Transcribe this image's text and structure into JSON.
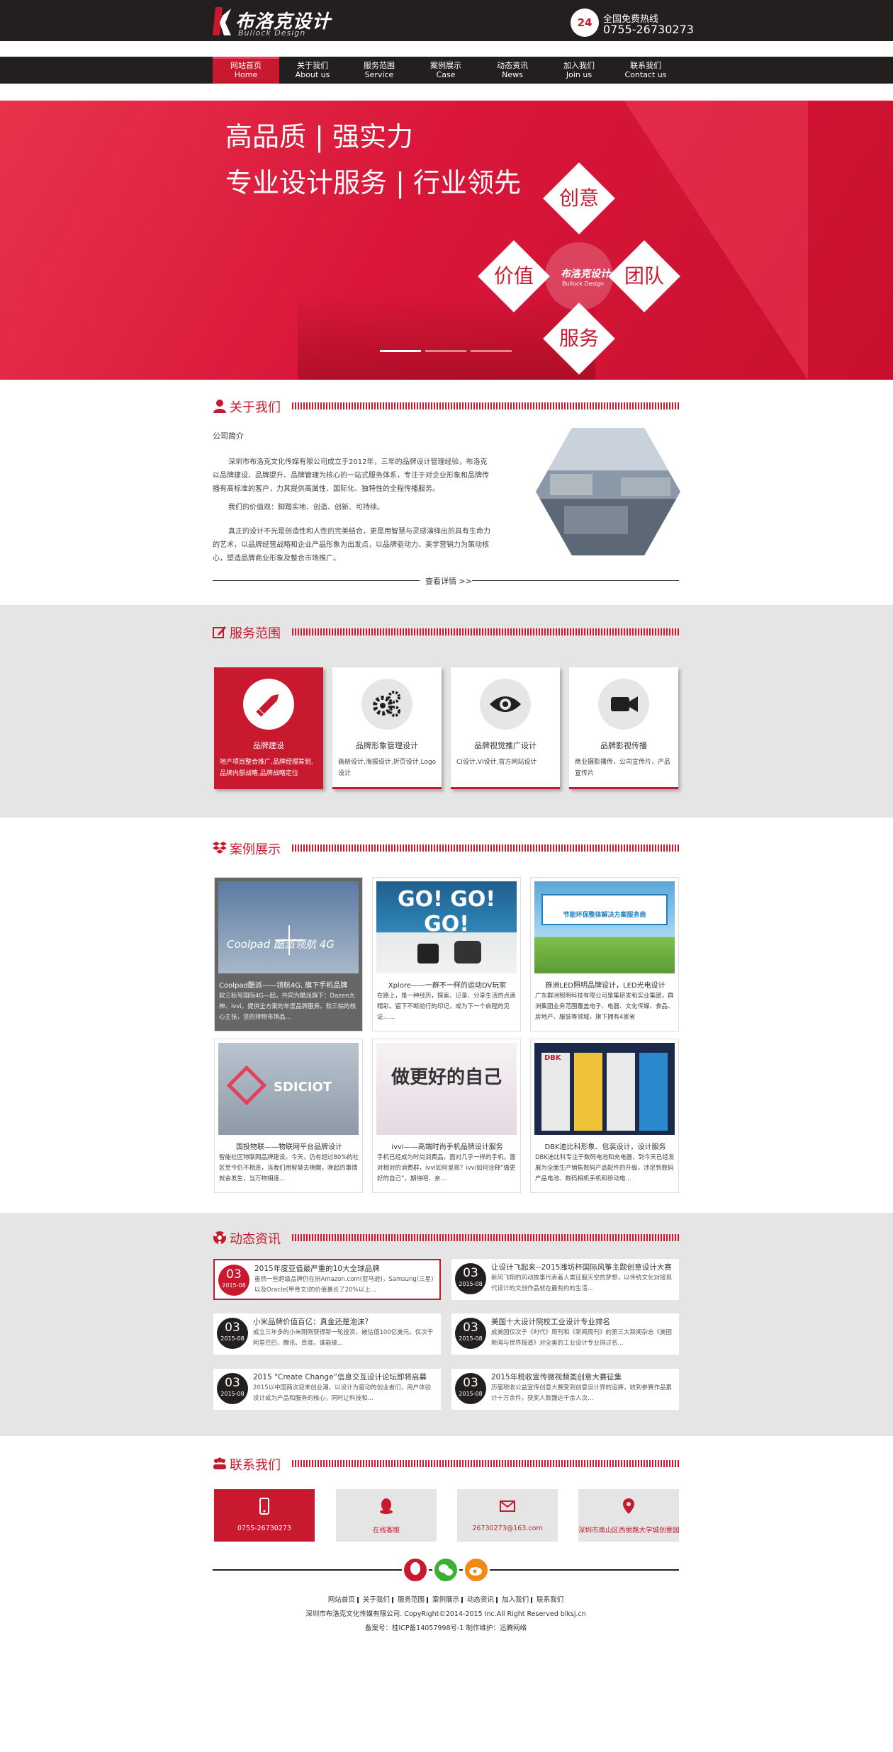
{
  "header": {
    "logo_cn": "布洛克设计",
    "logo_en": "Bullock Design",
    "hotline_badge": "24",
    "hotline_label": "全国免费热线",
    "hotline_number": "0755-26730273"
  },
  "nav": [
    {
      "cn": "网站首页",
      "en": "Home"
    },
    {
      "cn": "关于我们",
      "en": "About us"
    },
    {
      "cn": "服务范围",
      "en": "Service"
    },
    {
      "cn": "案例展示",
      "en": "Case"
    },
    {
      "cn": "动态资讯",
      "en": "News"
    },
    {
      "cn": "加入我们",
      "en": "Join us"
    },
    {
      "cn": "联系我们",
      "en": "Contact us"
    }
  ],
  "banner": {
    "line1": "高品质 | 强实力",
    "line2": "专业设计服务 | 行业领先",
    "words": [
      "创意",
      "价值",
      "团队",
      "服务"
    ],
    "center_logo": "布洛克设计",
    "center_logo_en": "Bullock Design"
  },
  "about": {
    "title": "关于我们",
    "subtitle": "公司简介",
    "p1": "深圳市布洛克文化传媒有限公司成立于2012年，三年的品牌设计管理经验，布洛克以品牌建设、品牌提升、品牌管理为核心的一站式服务体系，专注于对企业形象和品牌传播有高标准的客户，力其提供高属性、国际化、独特性的全程传播服务。",
    "p2": "我们的价值观：脚踏实地、创造、创新、可持续。",
    "p3": "真正的设计不光是创造性和人性的完美结合，更是用智慧与灵感演绎出的具有生命力的艺术，以品牌经营战略和企业产品形象为出发点，以品牌驱动力、美学营销力为策动核心，塑造品牌商业形象及整合市场推广。",
    "more": "查看详情 >>"
  },
  "services": {
    "title": "服务范围",
    "cards": [
      {
        "title": "品牌建设",
        "desc": "地产项目整合推广,品牌经理筹划,品牌内部战略,品牌战略定位",
        "icon": "pencil-icon"
      },
      {
        "title": "品牌形象管理设计",
        "desc": "画册设计,海报设计,折页设计,Logo设计",
        "icon": "gears-icon"
      },
      {
        "title": "品牌视觉推广设计",
        "desc": "CI设计,VI设计,官方网站设计",
        "icon": "eye-icon"
      },
      {
        "title": "品牌影视传播",
        "desc": "商业摄影播传，公司宣传片，产品宣传片",
        "icon": "video-camera-icon"
      }
    ]
  },
  "cases": {
    "title": "案例展示",
    "items": [
      {
        "title": "Coolpad酷派——领航4G, 旗下手机品牌",
        "desc": "软三标号国际4G—起，共同为酷派旗下：Dazen大神、ivvi。提供全方案的年度品牌服务。软三棕的核心主张，坚的持物市场品...",
        "img_text": "Coolpad 酷派领航 4G"
      },
      {
        "title": "Xplore——一群不一样的运动DV玩家",
        "desc": "在路上，是一种经历，探索、记录、分享生活的点滴精彩。留下不断前行的印记，成为下一个启程的见证……",
        "img_text": "GO! GO! GO!"
      },
      {
        "title": "群洲LED照明品牌设计，LED光电设计",
        "desc": "广东群洲照明科技有限公司是集研发和实业集团，群洲集团业务范围覆盖电子、电器、文化传媒、食品、房地产、服装等领域，旗下拥有4家省",
        "img_text": "节能环保整体解决方案服务商"
      },
      {
        "title": "国投物联——物联网平台品牌设计",
        "desc": "智能社区物联网品牌建设。今天，仍有超过80%的社区至今仍不相连，当我们用智慧去唤醒，唤起的事情就会发生，当万物相连...",
        "img_text": "SDICIOT"
      },
      {
        "title": "ivvi——高端时尚手机品牌设计服务",
        "desc": "手机已经成为时尚消费品，面对几乎一样的手机，面对相对的消费群，ivvi如何呈现？ivvi如何诠释“做更好的自己”，期待吧，亲...",
        "img_text": "做更好的自己"
      },
      {
        "title": "DBK迪比科形象、包装设计，设计服务",
        "desc": "DBK迪比科专注于数码电池和充电器，到今天已经发展为全面生产销售数码产品配件的升级，涉足到数码产品电池、数码相机手机和移动电...",
        "img_text": "DBK"
      }
    ]
  },
  "news": {
    "title": "动态资讯",
    "items": [
      {
        "day": "03",
        "month": "2015-08",
        "title": "2015年度亚值最严重的10大全球品牌",
        "desc": "虽然一些超级品牌仍在扮Amazon.com(亚马逊)，Samsung(三星)以及Oracle(甲骨文)的价值暴长了20%以上..."
      },
      {
        "day": "03",
        "month": "2015-08",
        "title": "让设计飞起来--2015潍坊杯国际风筝主题创意设计大赛",
        "desc": "新风飞翔的风动故事代表着人类征服天空的梦想，以传统文化对接现代设计的文创作品就在最有约的生活..."
      },
      {
        "day": "03",
        "month": "2015-08",
        "title": "小米品牌价值百亿：真金还是泡沫?",
        "desc": "成立三年多的小米刚刚获得新一轮投资，被估值100亿美元，仅次于阿里巴巴、腾讯、百度。谁能被..."
      },
      {
        "day": "03",
        "month": "2015-08",
        "title": "美国十大设计院校工业设计专业排名",
        "desc": "成美国仅次于《时代》周刊和《新闻周刊》的第三大新闻杂志《美国新闻与世界报道》对全美的工业设计专业排过名..."
      },
      {
        "day": "03",
        "month": "2015-08",
        "title": "2015 “Create Change”信息交互设计论坛即将启幕",
        "desc": "2015以中国两次迎来创业潮，以设计为驱动的创业者们，用户体验设计成为产品和服务的核心，同时让科技和..."
      },
      {
        "day": "03",
        "month": "2015-08",
        "title": "2015年税收宣传微视频类创意大赛征集",
        "desc": "历届税收公益宣传创意大赛受到创意设计界的追捧，收到参赛作品累计十万余件，获奖人数魏达千余人次..."
      }
    ]
  },
  "contact": {
    "title": "联系我们",
    "items": [
      {
        "text": "0755-26730273",
        "icon": "phone-icon"
      },
      {
        "text": "在线客服",
        "icon": "qq-icon"
      },
      {
        "text": "26730273@163.com",
        "icon": "mail-icon"
      },
      {
        "text": "深圳市南山区西丽路大学城创意园",
        "icon": "location-pin-icon"
      }
    ]
  },
  "footer": {
    "links": [
      "网站首页",
      "关于我们",
      "服务范围",
      "案例展示",
      "动态资讯",
      "加入我们",
      "联系我们"
    ],
    "copyright": "深圳市布洛克文化传媒有限公司. CopyRight©2014-2015 Inc.All Right Reserved blksj.cn",
    "icp": "备案号：桂ICP备14057998号-1 制作维护：迅腾网络"
  },
  "colors": {
    "brand": "#c8192e",
    "dark": "#231f1e",
    "gray": "#e5e5e5"
  }
}
